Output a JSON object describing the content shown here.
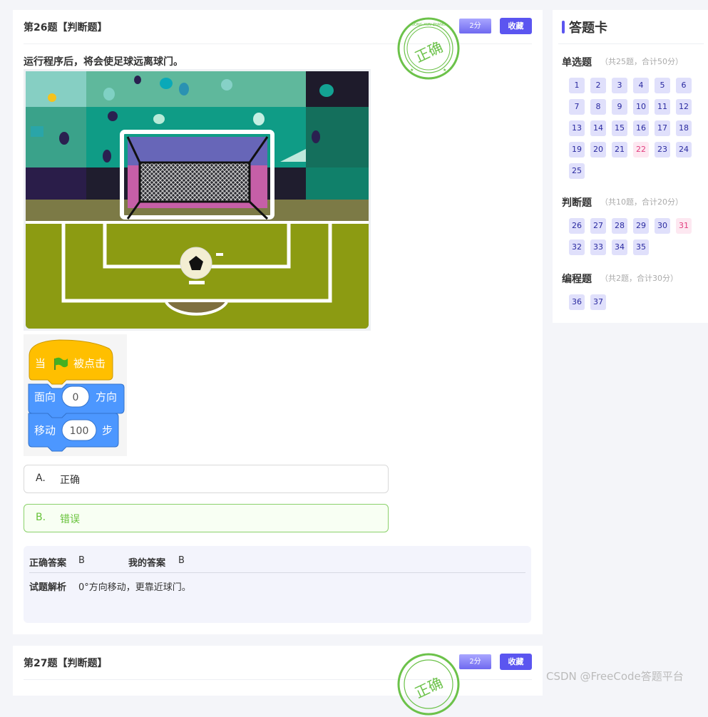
{
  "question26": {
    "header": "第26题【判断题】",
    "score": "2分",
    "favorite": "收藏",
    "stamp_text": "正确",
    "stamp_ring_text": "GONG XUN ZHANG",
    "text": "运行程序后，将会使足球远离球门。",
    "blocks": {
      "hat_prefix": "当",
      "hat_suffix": "被点击",
      "point_label": "面向",
      "point_value": "0",
      "point_suffix": "方向",
      "move_label": "移动",
      "move_value": "100",
      "move_suffix": "步"
    },
    "options": [
      {
        "letter": "A.",
        "text": "正确"
      },
      {
        "letter": "B.",
        "text": "错误"
      }
    ],
    "answer": {
      "correct_label": "正确答案",
      "correct_value": "B",
      "mine_label": "我的答案",
      "mine_value": "B",
      "analysis_label": "试题解析",
      "analysis_value": "0°方向移动，更靠近球门。"
    }
  },
  "question27": {
    "header": "第27题【判断题】",
    "score": "2分",
    "favorite": "收藏"
  },
  "answer_card": {
    "title": "答题卡",
    "sections": [
      {
        "title": "单选题",
        "meta": "（共25题，合计50分）"
      },
      {
        "title": "判断题",
        "meta": "（共10题，合计20分）"
      },
      {
        "title": "编程题",
        "meta": "（共2题，合计30分）"
      }
    ],
    "single_choice": [
      "1",
      "2",
      "3",
      "4",
      "5",
      "6",
      "7",
      "8",
      "9",
      "10",
      "11",
      "12",
      "13",
      "14",
      "15",
      "16",
      "17",
      "18",
      "19",
      "20",
      "21",
      "22",
      "23",
      "24",
      "25"
    ],
    "true_false": [
      "26",
      "27",
      "28",
      "29",
      "30",
      "31",
      "32",
      "33",
      "34",
      "35"
    ],
    "programming": [
      "36",
      "37"
    ],
    "highlighted": [
      "22",
      "31"
    ]
  },
  "watermark": "CSDN @FreeCode答题平台",
  "colors": {
    "accent": "#5b55f0",
    "correct_green": "#67c23a",
    "wrong_pink": "#e23d7e"
  }
}
